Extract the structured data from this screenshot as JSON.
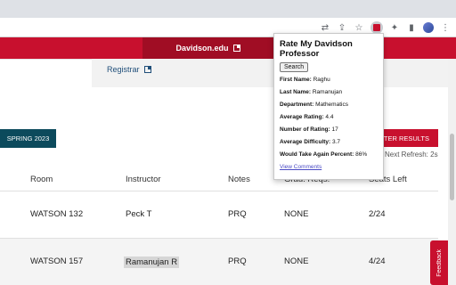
{
  "colors": {
    "brand_red": "#c8102e",
    "term_teal": "#0c4a5c"
  },
  "browser": {
    "extension_icons": [
      "translate-icon",
      "share-icon",
      "star-icon",
      "rmp-extension-icon",
      "puzzle-icon",
      "sidepanel-icon",
      "avatar",
      "menu-icon"
    ]
  },
  "site": {
    "davidson_link": "Davidson.edu",
    "registrar_link": "Registrar"
  },
  "term": "SPRING 2023",
  "filter_label": "TER RESULTS",
  "next_refresh": "Next Refresh: 2s",
  "table": {
    "headers": [
      "Room",
      "Instructor",
      "Notes",
      "Grad. Reqs.",
      "Seats Left"
    ],
    "rows": [
      [
        "WATSON 132",
        "Peck T",
        "PRQ",
        "NONE",
        "2/24"
      ],
      [
        "WATSON 157",
        "Ramanujan R",
        "PRQ",
        "NONE",
        "4/24"
      ]
    ]
  },
  "feedback": "Feedback",
  "popup": {
    "title": "Rate My Davidson Professor",
    "search_label": "Search",
    "fields": [
      {
        "label": "First Name:",
        "value": "Raghu"
      },
      {
        "label": "Last Name:",
        "value": "Ramanujan"
      },
      {
        "label": "Department:",
        "value": "Mathematics"
      },
      {
        "label": "Average Rating:",
        "value": "4.4"
      },
      {
        "label": "Number of Rating:",
        "value": "17"
      },
      {
        "label": "Average Difficulty:",
        "value": "3.7"
      },
      {
        "label": "Would Take Again Percent:",
        "value": "86%"
      }
    ],
    "view_comments": "View Comments"
  }
}
